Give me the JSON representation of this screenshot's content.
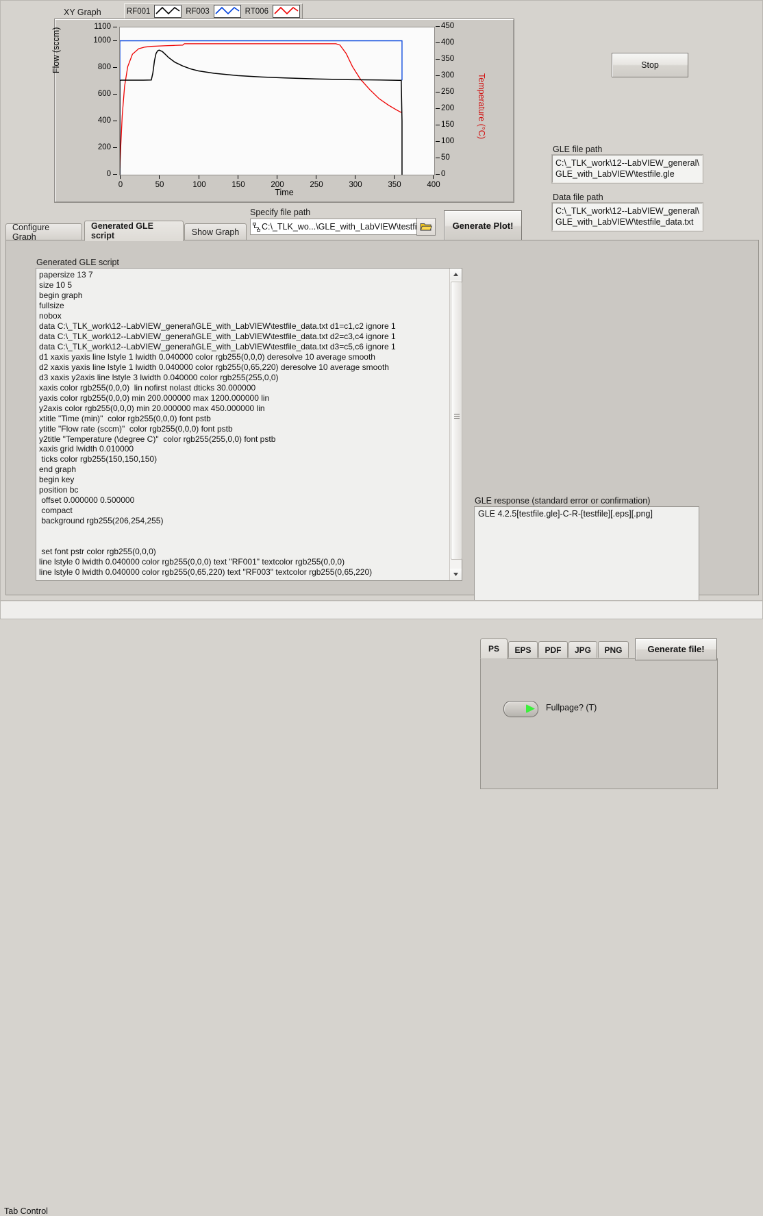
{
  "graph": {
    "title": "XY Graph",
    "legend": [
      {
        "name": "RF001",
        "color": "#000000"
      },
      {
        "name": "RF003",
        "color": "#0041dc"
      },
      {
        "name": "RT006",
        "color": "#ee0000"
      }
    ],
    "y_label": "Flow (sccm)",
    "y2_label": "Temperature (°C)",
    "x_label": "Time",
    "y_ticks": [
      "0",
      "200",
      "400",
      "600",
      "800",
      "1000",
      "1100"
    ],
    "y2_ticks": [
      "0",
      "50",
      "100",
      "150",
      "200",
      "250",
      "300",
      "350",
      "400",
      "450"
    ],
    "x_ticks": [
      "0",
      "50",
      "100",
      "150",
      "200",
      "250",
      "300",
      "350",
      "400"
    ]
  },
  "chart_data": {
    "type": "line",
    "title": "XY Graph",
    "xlabel": "Time",
    "ylabel": "Flow (sccm)",
    "y2label": "Temperature (°C)",
    "xlim": [
      0,
      400
    ],
    "ylim": [
      0,
      1100
    ],
    "y2lim": [
      0,
      450
    ],
    "grid": false,
    "legend_position": "top",
    "series": [
      {
        "name": "RF001",
        "color": "#000000",
        "axis": "left",
        "x": [
          0,
          0,
          2,
          10,
          20,
          30,
          40,
          42,
          44,
          46,
          48,
          50,
          54,
          58,
          62,
          70,
          80,
          90,
          100,
          120,
          150,
          180,
          210,
          250,
          290,
          330,
          355,
          358,
          359,
          359
        ],
        "y": [
          0,
          705,
          706,
          706,
          706,
          706,
          707,
          760,
          850,
          905,
          925,
          930,
          920,
          898,
          875,
          840,
          812,
          790,
          775,
          757,
          740,
          730,
          723,
          715,
          710,
          707,
          705,
          705,
          400,
          0
        ]
      },
      {
        "name": "RF003",
        "color": "#0041dc",
        "axis": "left",
        "x": [
          0,
          0,
          40,
          100,
          200,
          300,
          355,
          359,
          359
        ],
        "y": [
          0,
          1000,
          1000,
          1000,
          1000,
          1000,
          1000,
          1000,
          705
        ]
      },
      {
        "name": "RT006",
        "color": "#ee0000",
        "axis": "right",
        "x": [
          0,
          1,
          3,
          6,
          10,
          16,
          24,
          32,
          40,
          48,
          58,
          70,
          80,
          82,
          100,
          140,
          200,
          250,
          275,
          280,
          288,
          296,
          306,
          318,
          330,
          342,
          352,
          358
        ],
        "y": [
          20,
          80,
          180,
          270,
          330,
          368,
          385,
          390,
          392,
          393,
          394,
          395,
          396,
          400,
          400,
          400,
          400,
          400,
          400,
          396,
          370,
          330,
          292,
          260,
          232,
          212,
          198,
          190
        ]
      }
    ]
  },
  "controls": {
    "stop_label": "Stop",
    "generate_plot_label": "Generate Plot!",
    "generate_file_label": "Generate file!",
    "browse_icon": "folder-icon",
    "path_glyph_icon": "path-symbol-icon"
  },
  "paths": {
    "gle_caption": "GLE file path",
    "gle_line1": "C:\\_TLK_work\\12--LabVIEW_general\\",
    "gle_line2": "GLE_with_LabVIEW\\testfile.gle",
    "data_caption": "Data file path",
    "data_line1": "C:\\_TLK_work\\12--LabVIEW_general\\",
    "data_line2": "GLE_with_LabVIEW\\testfile_data.txt",
    "specify_caption": "Specify file path",
    "specify_value": "C:\\_TLK_wo...\\GLE_with_LabVIEW\\testfile"
  },
  "tabs": {
    "items": [
      {
        "label": "Configure Graph",
        "active": false
      },
      {
        "label": "Generated GLE script",
        "active": true
      },
      {
        "label": "Show Graph",
        "active": false
      }
    ]
  },
  "script": {
    "caption": "Generated GLE script",
    "text": "papersize 13 7\nsize 10 5\nbegin graph\nfullsize\nnobox\ndata C:\\_TLK_work\\12--LabVIEW_general\\GLE_with_LabVIEW\\testfile_data.txt d1=c1,c2 ignore 1\ndata C:\\_TLK_work\\12--LabVIEW_general\\GLE_with_LabVIEW\\testfile_data.txt d2=c3,c4 ignore 1\ndata C:\\_TLK_work\\12--LabVIEW_general\\GLE_with_LabVIEW\\testfile_data.txt d3=c5,c6 ignore 1\nd1 xaxis yaxis line lstyle 1 lwidth 0.040000 color rgb255(0,0,0) deresolve 10 average smooth\nd2 xaxis yaxis line lstyle 1 lwidth 0.040000 color rgb255(0,65,220) deresolve 10 average smooth\nd3 xaxis y2axis line lstyle 3 lwidth 0.040000 color rgb255(255,0,0)\nxaxis color rgb255(0,0,0)  lin nofirst nolast dticks 30.000000\nyaxis color rgb255(0,0,0) min 200.000000 max 1200.000000 lin\ny2axis color rgb255(0,0,0) min 20.000000 max 450.000000 lin\nxtitle \"Time (min)\"  color rgb255(0,0,0) font pstb\nytitle \"Flow rate (sccm)\"  color rgb255(0,0,0) font pstb\ny2title \"Temperature (\\degree C)\"  color rgb255(255,0,0) font pstb\nxaxis grid lwidth 0.010000\n ticks color rgb255(150,150,150)\nend graph\nbegin key\nposition bc\n offset 0.000000 0.500000\n compact\n background rgb255(206,254,255)\n\n\n set font pstr color rgb255(0,0,0)\nline lstyle 0 lwidth 0.040000 color rgb255(0,0,0) text \"RF001\" textcolor rgb255(0,0,0)\nline lstyle 0 lwidth 0.040000 color rgb255(0,65,220) text \"RF003\" textcolor rgb255(0,65,220)"
  },
  "response": {
    "caption": "GLE response (standard error or confirmation)",
    "text": "GLE 4.2.5[testfile.gle]-C-R-[testfile][.eps][.png]"
  },
  "format": {
    "tabs": [
      {
        "label": "PS",
        "active": true
      },
      {
        "label": "EPS",
        "active": false
      },
      {
        "label": "PDF",
        "active": false
      },
      {
        "label": "JPG",
        "active": false
      },
      {
        "label": "PNG",
        "active": false
      }
    ],
    "fullpage_label": "Fullpage? (T)",
    "fullpage_state": "on"
  },
  "status": {
    "tab_control_caption": "Tab Control"
  }
}
